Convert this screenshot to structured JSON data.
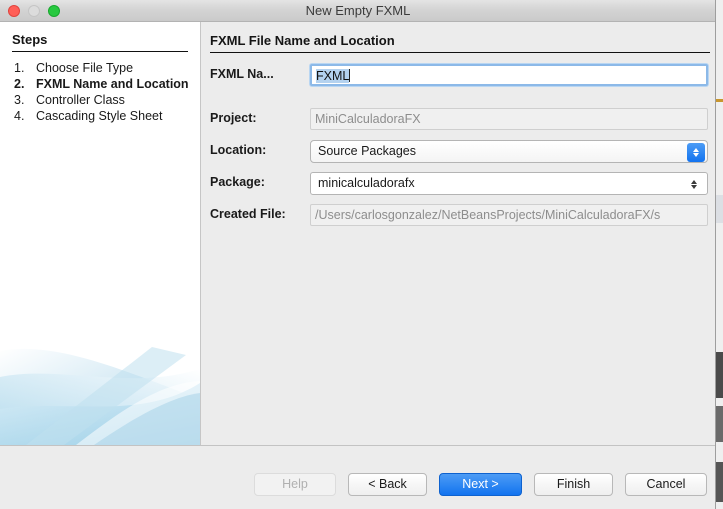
{
  "window": {
    "title": "New Empty FXML",
    "traffic_lights": [
      "close",
      "minimize",
      "zoom"
    ]
  },
  "steps_panel": {
    "heading": "Steps",
    "items": [
      {
        "num": "1.",
        "label": "Choose File Type",
        "current": false
      },
      {
        "num": "2.",
        "label": "FXML Name and Location",
        "current": true
      },
      {
        "num": "3.",
        "label": "Controller Class",
        "current": false
      },
      {
        "num": "4.",
        "label": "Cascading Style Sheet",
        "current": false
      }
    ]
  },
  "content": {
    "heading": "FXML File Name and Location",
    "fields": {
      "fxml_name": {
        "label": "FXML Na...",
        "value": "FXML",
        "selected_text": "FXML"
      },
      "project": {
        "label": "Project:",
        "value": "MiniCalculadoraFX"
      },
      "location": {
        "label": "Location:",
        "value": "Source Packages"
      },
      "package": {
        "label": "Package:",
        "value": "minicalculadorafx"
      },
      "created_file": {
        "label": "Created File:",
        "value": "/Users/carlosgonzalez/NetBeansProjects/MiniCalculadoraFX/s"
      }
    }
  },
  "buttons": {
    "help": "Help",
    "back": "< Back",
    "next": "Next >",
    "finish": "Finish",
    "cancel": "Cancel"
  },
  "colors": {
    "accent_blue": "#1273ef",
    "selection_blue": "#b4d2ef",
    "panel_gray": "#ececec",
    "panel_white": "#ffffff"
  }
}
